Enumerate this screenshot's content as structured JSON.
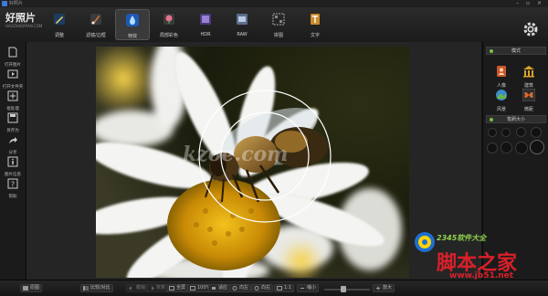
{
  "app": {
    "title": "好照片",
    "logo_main": "好照片",
    "logo_sub": "HAOZHAOPIAN.COM"
  },
  "toolbar": {
    "items": [
      {
        "label": "调整"
      },
      {
        "label": "滤镜/边框"
      },
      {
        "label": "特效"
      },
      {
        "label": "局部彩色"
      },
      {
        "label": "HDR"
      },
      {
        "label": "RAW"
      },
      {
        "label": "拼图"
      },
      {
        "label": "文字"
      }
    ]
  },
  "sidebar": {
    "items": [
      {
        "label": "打开图片"
      },
      {
        "label": "打开文件夹"
      },
      {
        "label": "批处理"
      },
      {
        "label": "另存为"
      },
      {
        "label": "分享"
      },
      {
        "label": "图片信息"
      },
      {
        "label": "帮助"
      }
    ]
  },
  "right_panel": {
    "mode_header": "模式",
    "modes": [
      {
        "label": "人像"
      },
      {
        "label": "建筑"
      },
      {
        "label": "风景"
      },
      {
        "label": "微距"
      }
    ],
    "brush_header": "笔刷大小"
  },
  "bottom": {
    "buttons": [
      {
        "label": "原图"
      },
      {
        "label": "比较/对比"
      },
      {
        "label": "撤销"
      },
      {
        "label": "恢复"
      },
      {
        "label": "全屏"
      },
      {
        "label": "100%"
      },
      {
        "label": "适应"
      },
      {
        "label": "向左"
      },
      {
        "label": "向右"
      },
      {
        "label": "1:1"
      },
      {
        "label": "缩小"
      },
      {
        "label": "放大"
      }
    ]
  },
  "watermarks": {
    "center": "kzoe.com",
    "brand_cn": "脚本之家",
    "url": "www.jb51.net",
    "badge_text": "2345软件大全"
  },
  "colors": {
    "accent_blue": "#3b7ad9",
    "active_dot": "#79c142",
    "watermark_red": "#d9202a"
  }
}
